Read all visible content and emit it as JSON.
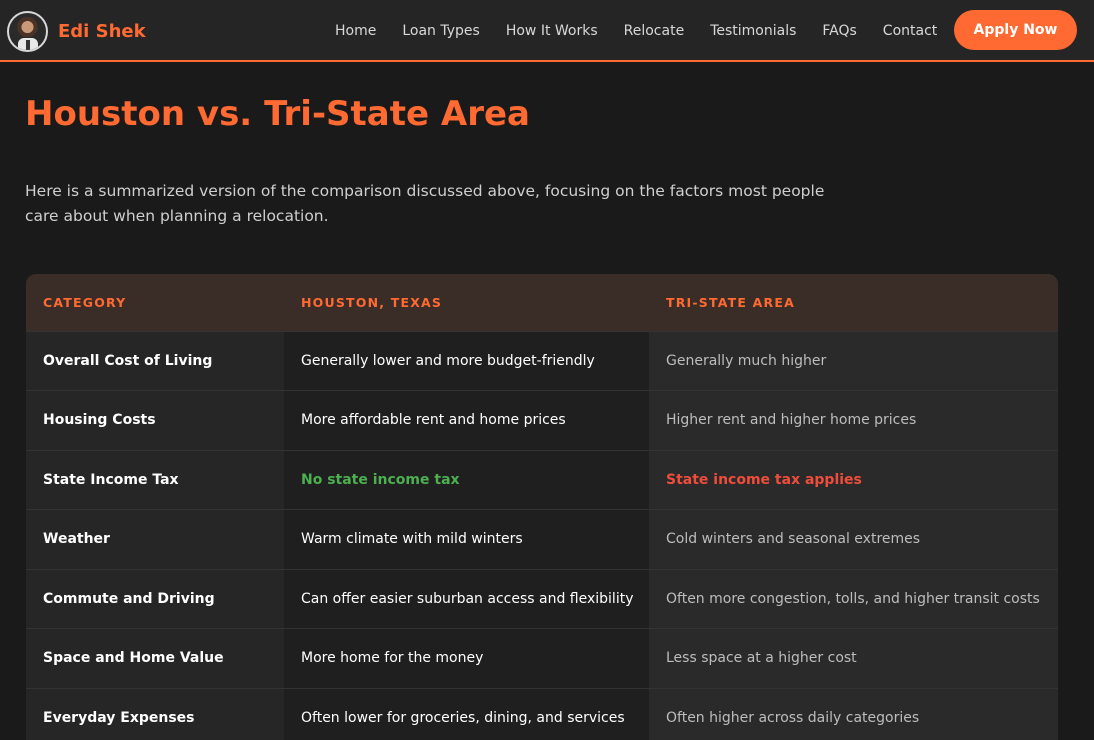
{
  "header": {
    "brand_name": "Edi Shek",
    "nav": [
      "Home",
      "Loan Types",
      "How It Works",
      "Relocate",
      "Testimonials",
      "FAQs",
      "Contact"
    ],
    "cta_label": "Apply Now"
  },
  "main": {
    "title": "Houston vs. Tri-State Area",
    "intro": "Here is a summarized version of the comparison discussed above, focusing on the factors most people care about when planning a relocation.",
    "table": {
      "headers": [
        "CATEGORY",
        "HOUSTON, TEXAS",
        "TRI-STATE AREA"
      ],
      "rows": [
        [
          "Overall Cost of Living",
          "Generally lower and more budget-friendly",
          "Generally much higher"
        ],
        [
          "Housing Costs",
          "More affordable rent and home prices",
          "Higher rent and higher home prices"
        ],
        [
          "State Income Tax",
          "No state income tax",
          "State income tax applies"
        ],
        [
          "Weather",
          "Warm climate with mild winters",
          "Cold winters and seasonal extremes"
        ],
        [
          "Commute and Driving",
          "Can offer easier suburban access and flexibility",
          "Often more congestion, tolls, and higher transit costs"
        ],
        [
          "Space and Home Value",
          "More home for the money",
          "Less space at a higher cost"
        ],
        [
          "Everyday Expenses",
          "Often lower for groceries, dining, and services",
          "Often higher across daily categories"
        ]
      ]
    }
  },
  "colors": {
    "accent": "#ff6a33",
    "positive": "#4caf50",
    "negative": "#ef4d3c",
    "background": "#1a1a1a"
  }
}
